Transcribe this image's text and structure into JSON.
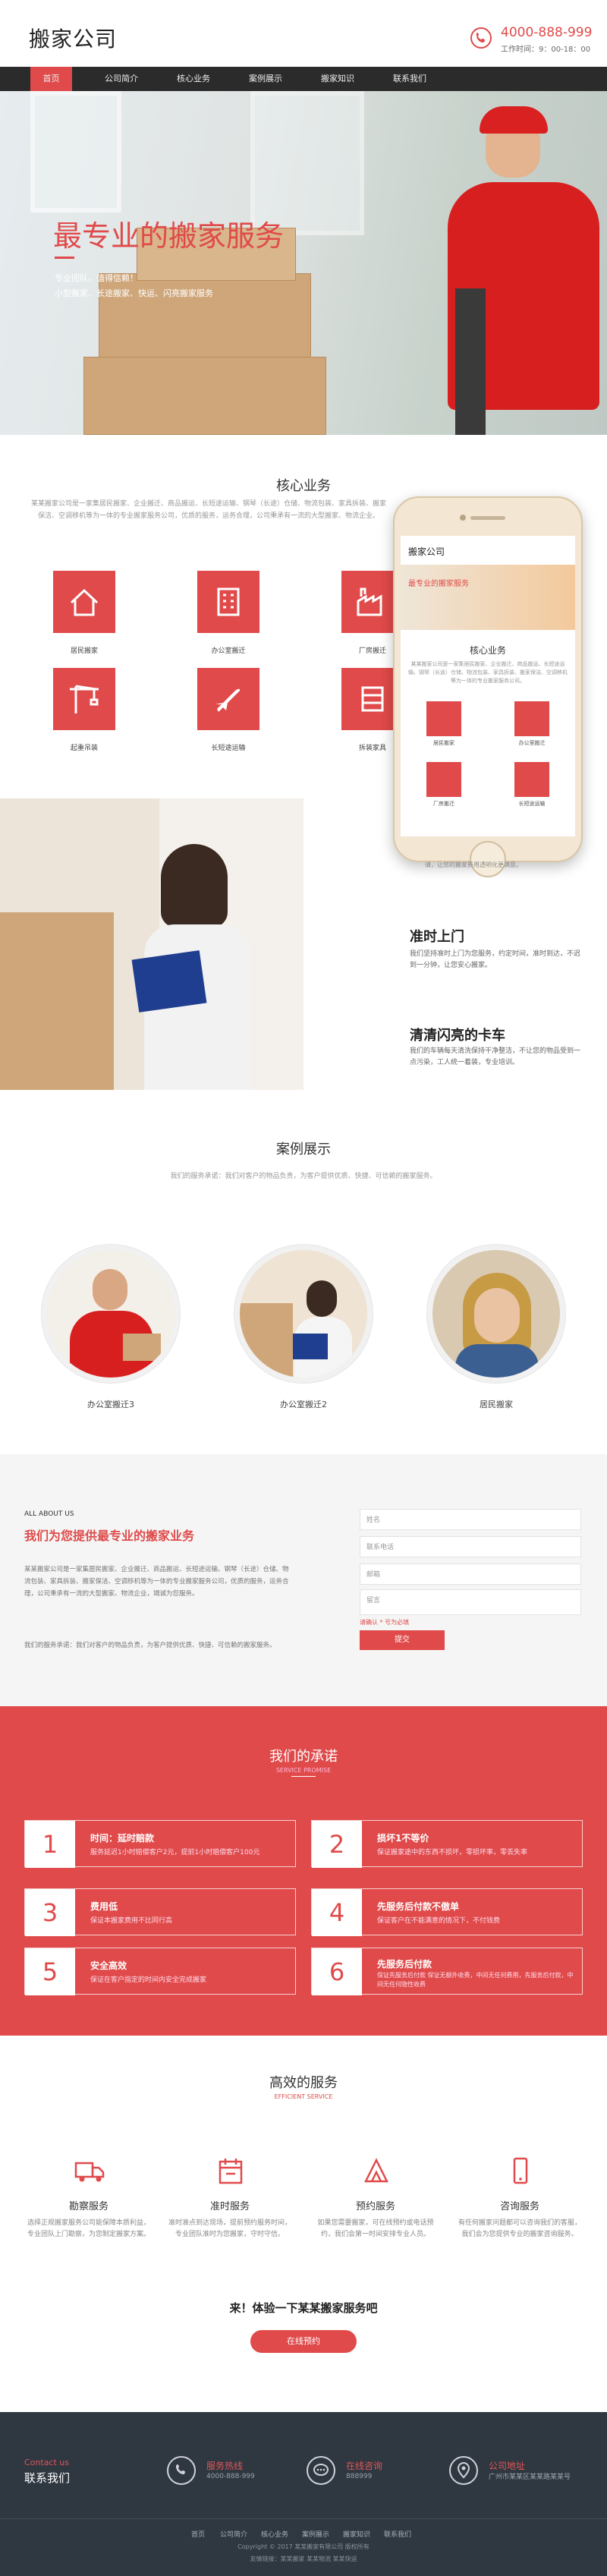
{
  "header": {
    "logo": "搬家公司",
    "phone": "4000-888-999",
    "worktime": "工作时间：9：00-18：00"
  },
  "nav": {
    "items": [
      "首页",
      "公司简介",
      "核心业务",
      "案例展示",
      "搬家知识",
      "联系我们"
    ],
    "active_index": 0
  },
  "hero": {
    "title": "最专业的搬家服务",
    "lines": [
      "专业团队，值得信赖！",
      "小型搬家、长途搬家、快运、闪亮搬家服务"
    ]
  },
  "core": {
    "title": "核心业务",
    "desc": "某某搬家公司是一家集居民搬家、企业搬迁、商品搬运、长短途运输、钢琴（长途）仓储、物流包装、家具拆装、搬家保洁、空调移机等为一体的专业搬家服务公司，优质的服务，运务合理，公司秉承有一流的大型搬家、物流企业。",
    "items": [
      {
        "label": "居民搬家",
        "icon": "house-icon"
      },
      {
        "label": "办公室搬迁",
        "icon": "office-building-icon"
      },
      {
        "label": "厂房搬迁",
        "icon": "factory-icon"
      },
      {
        "label": "起重吊装",
        "icon": "crane-icon"
      },
      {
        "label": "长短途运输",
        "icon": "airplane-icon"
      },
      {
        "label": "拆装家具",
        "icon": "furniture-icon"
      }
    ]
  },
  "phone_mock": {
    "logo": "搬家公司",
    "banner": "最专业的搬家服务",
    "title": "核心业务",
    "desc": "某某搬家公司是一家集居民搬家、企业搬迁、商品搬运、长短途运输、钢琴（长途）仓储、物流包装、家具拆装、搬家保洁、空调移机等为一体的专业搬家服务公司。",
    "labels": [
      "居民搬家",
      "办公室搬迁",
      "厂房搬迁",
      "长短途运输"
    ],
    "caption": "请，让您的搬家费用透明化更满意。"
  },
  "features": [
    {
      "title": "准时上门",
      "text": "我们坚持准时上门为您服务，约定时间，准时到达，不迟到一分钟，让您安心搬家。"
    },
    {
      "title": "清清闪亮的卡车",
      "text": "我们的车辆每天清洗保持干净整洁，不让您的物品受到一点污染，工人统一着装，专业培训。"
    }
  ],
  "cases": {
    "title": "案例展示",
    "desc": "我们的服务承诺：我们对客户的物品负责，为客户提供优质、快捷、可信赖的搬家服务。",
    "items": [
      "办公室搬迁3",
      "办公室搬迁2",
      "居民搬家"
    ]
  },
  "about": {
    "kicker": "ALL ABOUT US",
    "title": "我们为您提供最专业的搬家业务",
    "para1": "某某搬家公司是一家集居民搬家、企业搬迁、商品搬运、长短途运输、钢琴（长途）仓储、物流包装、家具拆装、搬家保洁、空调移机等为一体的专业搬家服务公司，优质的服务，运务合理，公司秉承有一流的大型搬家、物流企业，竭诚为您服务。",
    "para2": "我们的服务承诺：我们对客户的物品负责，为客户提供优质、快捷、可信赖的搬家服务。",
    "form": {
      "fields": [
        "姓名",
        "联系电话",
        "邮箱",
        "留言"
      ],
      "required_note": "请确认 * 号为必填",
      "submit": "提交"
    }
  },
  "promise": {
    "title": "我们的承诺",
    "subtitle": "SERVICE PROMISE",
    "items": [
      {
        "num": "1",
        "title": "时间：延时赔款",
        "text": "服务延迟1小时赔偿客户2元，提前1小时赔偿客户100元"
      },
      {
        "num": "2",
        "title": "损坏1不等价",
        "text": "保证搬家途中的东西不损坏，零损坏率，零丢失率"
      },
      {
        "num": "3",
        "title": "费用低",
        "text": "保证本搬家费用不比同行高"
      },
      {
        "num": "4",
        "title": "先服务后付款不傲单",
        "text": "保证客户在不能满意的情况下，不付钱费"
      },
      {
        "num": "5",
        "title": "安全高效",
        "text": "保证在客户指定的时间内安全完成搬家"
      },
      {
        "num": "6",
        "title": "先服务后付款",
        "text": "保证先服务后付款 保证无额外收费，中间无任何费用，先服务后付款，中间无任何隐性收费"
      }
    ]
  },
  "efficient": {
    "title": "高效的服务",
    "subtitle": "EFFICIENT SERVICE",
    "items": [
      {
        "title": "勘察服务",
        "icon": "truck-icon",
        "text": "选择正规搬家服务公司能保障本质利益，专业团队上门勘察，为您制定搬家方案。"
      },
      {
        "title": "准时服务",
        "icon": "calendar-icon",
        "text": "准时准点到达现场，提前预约服务时间，专业团队准时为您搬家，守时守信。"
      },
      {
        "title": "预约服务",
        "icon": "tools-icon",
        "text": "如果您需要搬家，可在线预约或电话预约，我们会第一时间安排专业人员。"
      },
      {
        "title": "咨询服务",
        "icon": "mobile-phone-icon",
        "text": "有任何搬家问题都可以咨询我们的客服，我们会为您提供专业的搬家咨询服务。"
      }
    ],
    "cta_text": "来！体验一下某某搬家服务吧",
    "cta_button": "在线预约"
  },
  "footer": {
    "contact_label": "Contact us",
    "contact_title": "联系我们",
    "cols": [
      {
        "label": "服务热线",
        "value": "4000-888-999",
        "icon": "phone-icon"
      },
      {
        "label": "在线咨询",
        "value": "888999",
        "icon": "chat-icon"
      },
      {
        "label": "公司地址",
        "value": "广州市某某区某某路某某号",
        "icon": "location-icon"
      }
    ],
    "links": [
      "首页",
      "公司简介",
      "核心业务",
      "案例展示",
      "搬家知识",
      "联系我们"
    ],
    "copyright": "Copyright © 2017 某某搬家有限公司 版权所有",
    "links_note": "友情链接：某某搬家 某某物流 某某快运"
  },
  "colors": {
    "accent": "#e04a4a",
    "nav_bg": "#2b2b2b",
    "footer_bg": "#2f3741"
  }
}
